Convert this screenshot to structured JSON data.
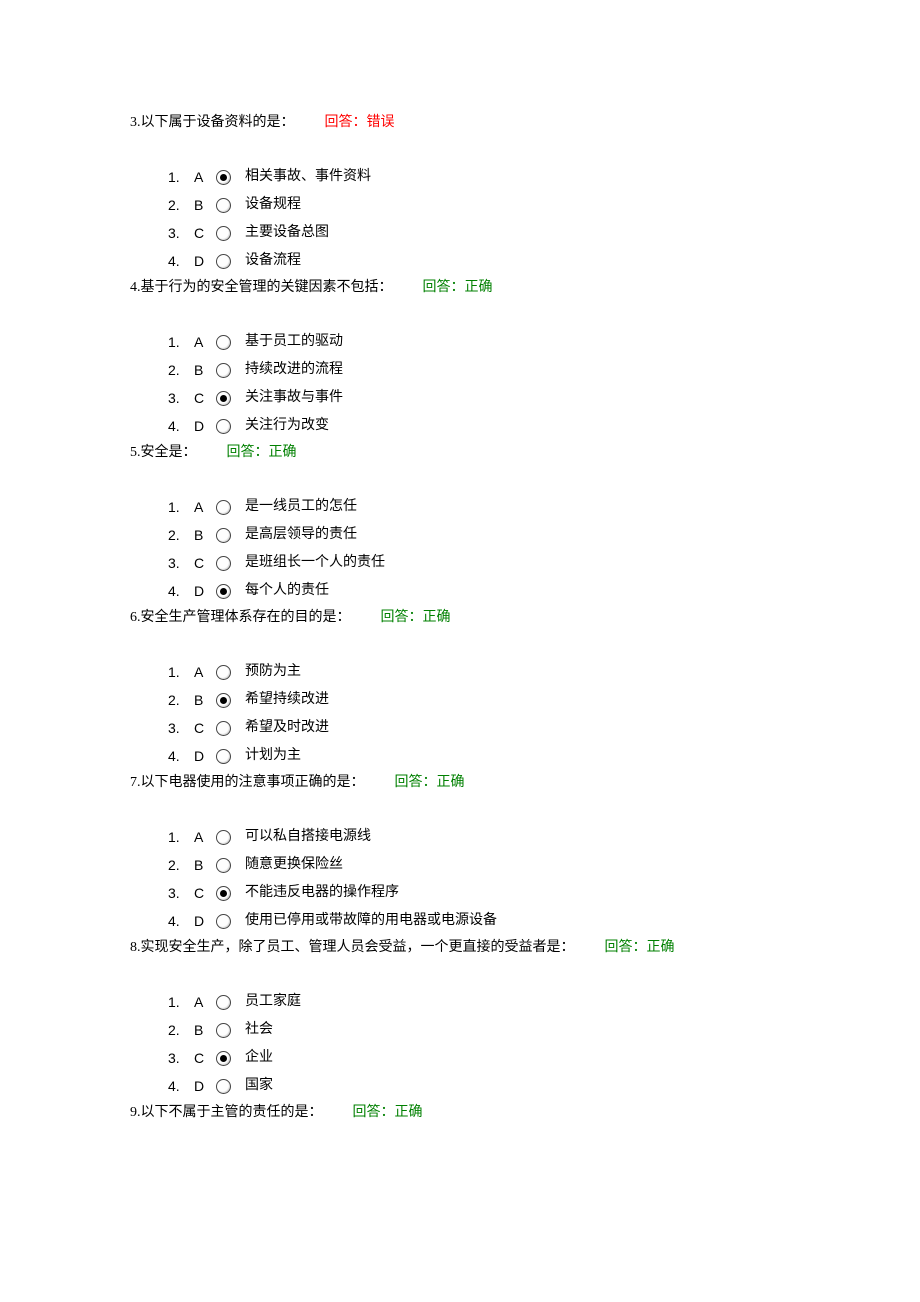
{
  "answer_prefix": "回答：",
  "answer_correct": "正确",
  "answer_wrong": "错误",
  "questions": [
    {
      "num": "3.",
      "text": "以下属于设备资料的是：",
      "status": "wrong",
      "options": [
        {
          "n": "1.",
          "l": "A",
          "sel": true,
          "t": "相关事故、事件资料"
        },
        {
          "n": "2.",
          "l": "B",
          "sel": false,
          "t": "设备规程"
        },
        {
          "n": "3.",
          "l": "C",
          "sel": false,
          "t": "主要设备总图"
        },
        {
          "n": "4.",
          "l": "D",
          "sel": false,
          "t": "设备流程"
        }
      ]
    },
    {
      "num": "4.",
      "text": "基于行为的安全管理的关键因素不包括：",
      "status": "correct",
      "options": [
        {
          "n": "1.",
          "l": "A",
          "sel": false,
          "t": "基于员工的驱动"
        },
        {
          "n": "2.",
          "l": "B",
          "sel": false,
          "t": "持续改进的流程"
        },
        {
          "n": "3.",
          "l": "C",
          "sel": true,
          "t": "关注事故与事件"
        },
        {
          "n": "4.",
          "l": "D",
          "sel": false,
          "t": "关注行为改变"
        }
      ]
    },
    {
      "num": "5.",
      "text": "安全是：",
      "status": "correct",
      "options": [
        {
          "n": "1.",
          "l": "A",
          "sel": false,
          "t": "是一线员工的怎任"
        },
        {
          "n": "2.",
          "l": "B",
          "sel": false,
          "t": "是高层领导的责任"
        },
        {
          "n": "3.",
          "l": "C",
          "sel": false,
          "t": "是班组长一个人的责任"
        },
        {
          "n": "4.",
          "l": "D",
          "sel": true,
          "t": "每个人的责任"
        }
      ]
    },
    {
      "num": "6.",
      "text": "安全生产管理体系存在的目的是：",
      "status": "correct",
      "options": [
        {
          "n": "1.",
          "l": "A",
          "sel": false,
          "t": "预防为主"
        },
        {
          "n": "2.",
          "l": "B",
          "sel": true,
          "t": "希望持续改进"
        },
        {
          "n": "3.",
          "l": "C",
          "sel": false,
          "t": "希望及时改进"
        },
        {
          "n": "4.",
          "l": "D",
          "sel": false,
          "t": "计划为主"
        }
      ]
    },
    {
      "num": "7.",
      "text": "以下电器使用的注意事项正确的是：",
      "status": "correct",
      "options": [
        {
          "n": "1.",
          "l": "A",
          "sel": false,
          "t": "可以私自搭接电源线"
        },
        {
          "n": "2.",
          "l": "B",
          "sel": false,
          "t": "随意更换保险丝"
        },
        {
          "n": "3.",
          "l": "C",
          "sel": true,
          "t": "不能违反电器的操作程序"
        },
        {
          "n": "4.",
          "l": "D",
          "sel": false,
          "t": "使用已停用或带故障的用电器或电源设备"
        }
      ]
    },
    {
      "num": "8.",
      "text": "实现安全生产，除了员工、管理人员会受益，一个更直接的受益者是：",
      "status": "correct",
      "options": [
        {
          "n": "1.",
          "l": "A",
          "sel": false,
          "t": "员工家庭"
        },
        {
          "n": "2.",
          "l": "B",
          "sel": false,
          "t": "社会"
        },
        {
          "n": "3.",
          "l": "C",
          "sel": true,
          "t": "企业"
        },
        {
          "n": "4.",
          "l": "D",
          "sel": false,
          "t": "国家"
        }
      ]
    },
    {
      "num": "9.",
      "text": "以下不属于主管的责任的是：",
      "status": "correct",
      "options": []
    }
  ]
}
